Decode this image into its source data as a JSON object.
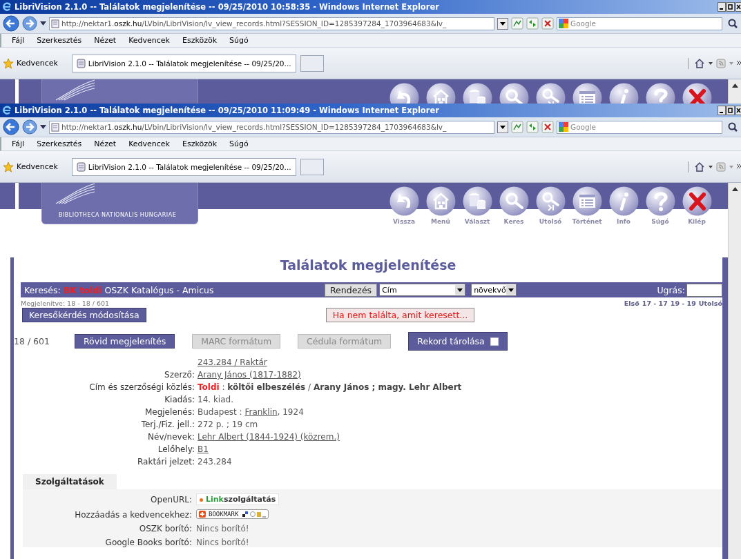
{
  "windows": [
    {
      "title": "LibriVision 2.1.0 -- Találatok megjelenítése -- 09/25/2010 10:58:35 - Windows Internet Explorer",
      "url": "http://nektar1.**oszk.hu**/LVbin/LibriVision/lv_view_records.html?SESSION_ID=1285397284_1703964683&lv_",
      "search_placeholder": "Google",
      "menu": [
        "Fájl",
        "Szerkesztés",
        "Nézet",
        "Kedvencek",
        "Eszközök",
        "Súgó"
      ],
      "favorites": "Kedvencek",
      "tab": "LibriVision 2.1.0 -- Találatok megjelenítése -- 09/25/20...",
      "page": {
        "toolbar": [
          {
            "kind": "back"
          },
          {
            "kind": "home"
          },
          {
            "kind": "databases"
          },
          {
            "kind": "search"
          },
          {
            "kind": "last"
          },
          {
            "kind": "history"
          },
          {
            "kind": "info"
          },
          {
            "kind": "help"
          },
          {
            "kind": "exit"
          }
        ]
      }
    },
    {
      "title": "LibriVision 2.1.0 -- Találatok megjelenítése -- 09/25/2010 11:09:49 - Windows Internet Explorer",
      "url": "http://nektar1.**oszk.hu**/LVbin/LibriVision/lv_view_records.html?SESSION_ID=1285397284_1703964683&lv_",
      "search_placeholder": "Google",
      "menu": [
        "Fájl",
        "Szerkesztés",
        "Nézet",
        "Kedvencek",
        "Eszközök",
        "Súgó"
      ],
      "favorites": "Kedvencek",
      "tab": "LibriVision 2.1.0 -- Találatok megjelenítése -- 09/25/20...",
      "page": {
        "logo_text": "BIBLIOTHECA NATIONALIS HUNGARIAE",
        "toolbar": [
          {
            "kind": "back",
            "label": "Vissza"
          },
          {
            "kind": "home",
            "label": "Menü"
          },
          {
            "kind": "databases",
            "label": "Választ"
          },
          {
            "kind": "search",
            "label": "Keres"
          },
          {
            "kind": "last",
            "label": "Utolsó"
          },
          {
            "kind": "history",
            "label": "Történet"
          },
          {
            "kind": "info",
            "label": "Info"
          },
          {
            "kind": "help",
            "label": "Súgó"
          },
          {
            "kind": "exit",
            "label": "Kilép"
          }
        ],
        "heading": "Találatok megjelenítése",
        "search_bar": {
          "label": "Keresés:",
          "query": "BK toldi",
          "catalog": "OSZK Katalógus - Amicus",
          "sort_button": "Rendezés",
          "sort_field": "Cím",
          "sort_order": "növekvő",
          "jump_label": "Ugrás:"
        },
        "shown": "Megjelenítve: 18 - 18 / 601",
        "pager": [
          "Első",
          "17 - 17",
          "19 - 19",
          "Utolsó"
        ],
        "modify_button": "Keresőkérdés módosítása",
        "not_found_button": "Ha nem találta, amit keresett...",
        "position": "18 / 601",
        "formats": [
          {
            "label": "Rövid megjelenítés",
            "selected": true
          },
          {
            "label": "MARC formátum",
            "selected": false
          },
          {
            "label": "Cédula formátum",
            "selected": false
          }
        ],
        "store": {
          "label": "Rekord tárolása",
          "checked": false
        },
        "call_number": "243.284 / Raktár",
        "fields": [
          {
            "label": "Szerző:",
            "parts": [
              {
                "kind": "link",
                "text": "Arany János (1817-1882)"
              }
            ]
          },
          {
            "label": "Cím és szerzőségi közlés:",
            "parts": [
              {
                "kind": "hit",
                "text": "Toldi"
              },
              {
                "kind": "plain",
                "text": " : "
              },
              {
                "kind": "bold",
                "text": "költői elbeszélés"
              },
              {
                "kind": "plain",
                "text": " / "
              },
              {
                "kind": "bold",
                "text": "Arany János ; magy. Lehr Albert"
              }
            ]
          },
          {
            "label": "Kiadás:",
            "parts": [
              {
                "kind": "plain",
                "text": "14. kiad."
              }
            ]
          },
          {
            "label": "Megjelenés:",
            "parts": [
              {
                "kind": "plain",
                "text": "Budapest : "
              },
              {
                "kind": "link",
                "text": "Franklin"
              },
              {
                "kind": "plain",
                "text": ", 1924"
              }
            ]
          },
          {
            "label": "Terj./Fiz. jell.:",
            "parts": [
              {
                "kind": "plain",
                "text": "272 p. ; 19 cm"
              }
            ]
          },
          {
            "label": "Név/nevek:",
            "parts": [
              {
                "kind": "link",
                "text": "Lehr Albert (1844-1924) (közrem.)"
              }
            ]
          },
          {
            "label": "Lelőhely:",
            "parts": [
              {
                "kind": "link",
                "text": "B1"
              }
            ]
          },
          {
            "label": "Raktári jelzet:",
            "parts": [
              {
                "kind": "plain",
                "text": "243.284"
              }
            ]
          }
        ],
        "services_tab": "Szolgáltatások",
        "services": [
          {
            "label": "OpenURL:",
            "kind": "linkservice",
            "prefix": "Link",
            "value": "szolgáltatás"
          },
          {
            "label": "Hozzáadás a kedvencekhez:",
            "kind": "bookmark",
            "value": "BOOKMARK"
          },
          {
            "label": "OSZK borító:",
            "kind": "text",
            "value": "Nincs borító!"
          },
          {
            "label": "Google Books borító:",
            "kind": "text",
            "value": "Nincs borító!"
          }
        ]
      }
    }
  ]
}
